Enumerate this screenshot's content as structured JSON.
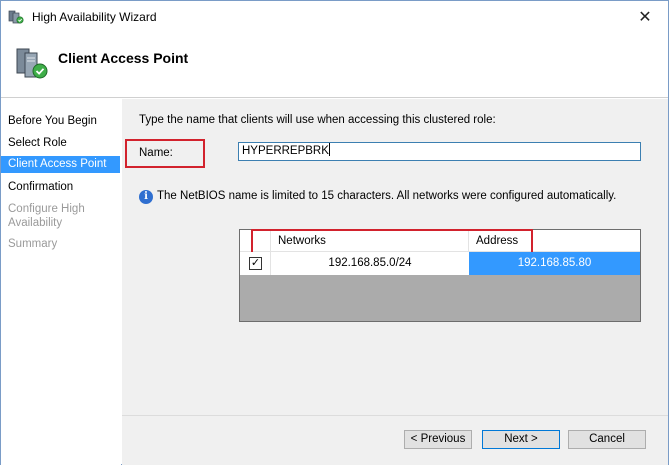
{
  "window": {
    "title": "High Availability Wizard",
    "close_glyph": "✕"
  },
  "header": {
    "title": "Client Access Point"
  },
  "nav": {
    "items": [
      {
        "label": "Before You Begin",
        "state": "normal"
      },
      {
        "label": "Select Role",
        "state": "normal"
      },
      {
        "label": "Client Access Point",
        "state": "active"
      },
      {
        "label": "Confirmation",
        "state": "normal"
      },
      {
        "label": "Configure High\nAvailability",
        "state": "disabled"
      },
      {
        "label": "Summary",
        "state": "disabled"
      }
    ]
  },
  "content": {
    "instruction": "Type the name that clients will use when accessing this clustered role:",
    "name_label": "Name:",
    "name_value": "HYPERREPBRK",
    "info_glyph": "i",
    "info_text": "The NetBIOS name is limited to 15 characters.  All networks were configured automatically.",
    "grid": {
      "headers": {
        "networks": "Networks",
        "address": "Address"
      },
      "rows": [
        {
          "checked": true,
          "check_glyph": "✓",
          "network": "192.168.85.0/24",
          "address": "192.168.85.80"
        }
      ]
    }
  },
  "buttons": {
    "previous": "< Previous",
    "next": "Next >",
    "cancel": "Cancel"
  },
  "colors": {
    "accent": "#3399ff",
    "highlight_box": "#d2222d"
  }
}
